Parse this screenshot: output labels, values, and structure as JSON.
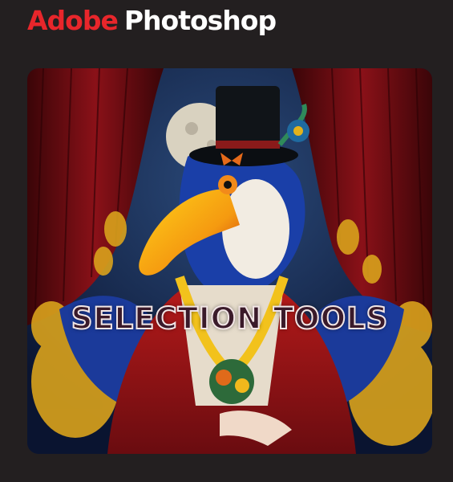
{
  "brand": {
    "company": "Adobe",
    "product": "Photoshop"
  },
  "hero": {
    "title": "SELECTION TOOLS",
    "illustration": "toucan-in-top-hat-with-red-curtains"
  },
  "colors": {
    "page_background": "#231f20",
    "brand_red": "#e8262b",
    "title_fill": "#3a1a2a",
    "title_outline": "#f2e6e6"
  }
}
